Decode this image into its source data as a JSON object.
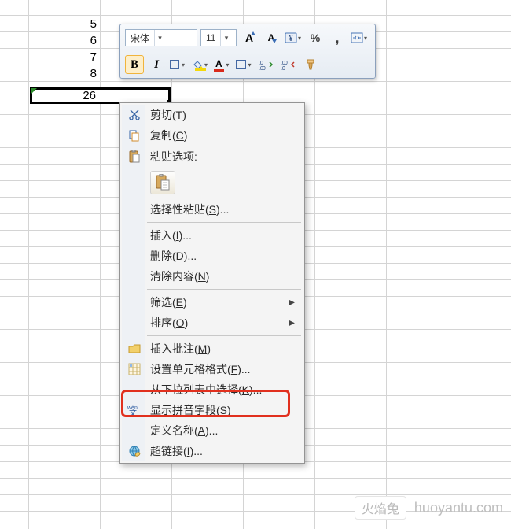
{
  "grid": {
    "row_labels": [
      "5",
      "6",
      "7",
      "8"
    ],
    "selected_value": "26"
  },
  "minibar": {
    "font_name": "宋体",
    "font_size": "11"
  },
  "icons": {
    "grow_font": "A",
    "shrink_font": "A",
    "percent": "%",
    "comma": ",",
    "bold": "B",
    "italic": "I",
    "font_color": "A",
    "inc_dec": ".00",
    "dec_dec": ".0"
  },
  "menu": {
    "cut_pre": "剪切(",
    "cut_key": "T",
    "cut_post": ")",
    "copy_pre": "复制(",
    "copy_key": "C",
    "copy_post": ")",
    "paste_opts": "粘贴选项:",
    "paste_special_pre": "选择性粘贴(",
    "paste_special_key": "S",
    "paste_special_post": ")...",
    "insert_pre": "插入(",
    "insert_key": "I",
    "insert_post": ")...",
    "delete_pre": "删除(",
    "delete_key": "D",
    "delete_post": ")...",
    "clear_pre": "清除内容(",
    "clear_key": "N",
    "clear_post": ")",
    "filter_pre": "筛选(",
    "filter_key": "E",
    "filter_post": ")",
    "sort_pre": "排序(",
    "sort_key": "O",
    "sort_post": ")",
    "comment_pre": "插入批注(",
    "comment_key": "M",
    "comment_post": ")",
    "format_pre": "设置单元格格式(",
    "format_key": "F",
    "format_post": ")...",
    "dropdown_pre": "从下拉列表中选择(",
    "dropdown_key": "K",
    "dropdown_post": ")...",
    "phonetic_pre": "显示拼音字段(",
    "phonetic_key": "S",
    "phonetic_post": ")",
    "name_pre": "定义名称(",
    "name_key": "A",
    "name_post": ")...",
    "link_pre": "超链接(",
    "link_key": "I",
    "link_post": ")...",
    "submenu_arrow": "▶"
  },
  "watermark": {
    "cn": "火焰兔",
    "url": "huoyantu.com"
  }
}
